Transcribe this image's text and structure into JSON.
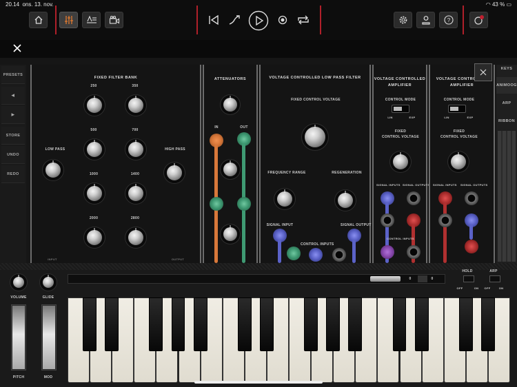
{
  "status": {
    "time": "20.14",
    "date": "ons. 13. nov.",
    "battery": "43 %"
  },
  "toolbar": {
    "left_buttons": [
      "home-icon",
      "mixer-icon",
      "text-editor-icon",
      "camera-icon"
    ],
    "transport": [
      "skip-back-icon",
      "curve-icon",
      "play-icon",
      "record-icon",
      "loop-icon"
    ],
    "right_buttons": [
      "gear-icon",
      "user-icon",
      "help-icon",
      "notification-icon"
    ],
    "accent": "#b0202a"
  },
  "close": {
    "icon": "close-icon"
  },
  "sidebar": {
    "items": [
      "PRESETS",
      "◀",
      "▶",
      "STORE",
      "UNDO",
      "REDO"
    ]
  },
  "right_sidebar": {
    "items": [
      "KEYS",
      "ANIMOOG",
      "ARP",
      "RIBBON"
    ]
  },
  "modules": {
    "filter_bank": {
      "title": "FIXED FILTER BANK",
      "low_pass": "LOW PASS",
      "high_pass": "HIGH PASS",
      "freqs": [
        "250",
        "350",
        "500",
        "700",
        "1000",
        "1400",
        "2000",
        "2800"
      ],
      "input": "INPUT",
      "output": "OUTPUT"
    },
    "attenuators": {
      "title": "ATTENUATORS",
      "in": "IN",
      "out": "OUT"
    },
    "vcf": {
      "title": "VOLTAGE CONTROLLED LOW PASS FILTER",
      "fixed_cv": "FIXED CONTROL VOLTAGE",
      "freq_range": "FREQUENCY RANGE",
      "regeneration": "REGENERATION",
      "signal_input": "SIGNAL INPUT",
      "control_inputs": "CONTROL INPUTS",
      "signal_output": "SIGNAL OUTPUT"
    },
    "vca1": {
      "title_a": "VOLTAGE CONTROLLED",
      "title_b": "AMPLIFIER",
      "control_mode": "CONTROL MODE",
      "lin": "LIN",
      "exp": "EXP",
      "fixed_a": "FIXED",
      "fixed_b": "CONTROL VOLTAGE",
      "signal_inputs": "SIGNAL INPUTS",
      "signal_outputs": "SIGNAL OUTPUTS",
      "control_inputs": "CONTROL INPUTS"
    },
    "vca2": {
      "title_a": "VOLTAGE CONTROLLED",
      "title_b": "AMPLIFIER",
      "control_mode": "CONTROL MODE",
      "lin": "LIN",
      "exp": "EXP",
      "fixed_a": "FIXED",
      "fixed_b": "CONTROL VOLTAGE",
      "signal_inputs": "SIGNAL INPUTS",
      "signal_outputs": "SIGNAL OUTPUTS"
    }
  },
  "keyboard": {
    "volume": "VOLUME",
    "glide": "GLIDE",
    "pitch": "PITCH",
    "mod": "MOD",
    "hold": "HOLD",
    "arp": "ARP",
    "off": "OFF",
    "on": "ON",
    "ribbon_value_a": "0",
    "ribbon_value_b": "0"
  },
  "colors": {
    "orange_cable": "#d8783a",
    "green_cable": "#3f9a73",
    "blue_cable": "#5b62c8",
    "red_cable": "#b03030",
    "purple_cable": "#8a4ab0"
  }
}
